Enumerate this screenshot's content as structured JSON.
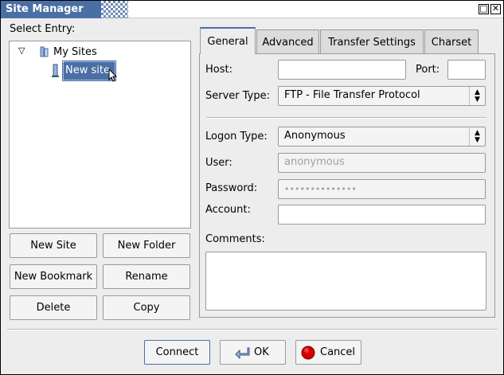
{
  "window": {
    "title": "Site Manager",
    "minimize_glyph": "□",
    "close_glyph": "✕"
  },
  "left": {
    "select_entry_label": "Select Entry:",
    "tree": {
      "root_label": "My Sites",
      "root_expander": "▽",
      "child_label": "New site"
    },
    "buttons": {
      "new_site": "New Site",
      "new_folder": "New Folder",
      "new_bookmark": "New Bookmark",
      "rename": "Rename",
      "delete": "Delete",
      "copy": "Copy"
    }
  },
  "tabs": {
    "general": "General",
    "advanced": "Advanced",
    "transfer_settings": "Transfer Settings",
    "charset": "Charset"
  },
  "general": {
    "host_label": "Host:",
    "host_value": "",
    "port_label": "Port:",
    "port_value": "",
    "server_type_label": "Server Type:",
    "server_type_value": "FTP - File Transfer Protocol",
    "logon_type_label": "Logon Type:",
    "logon_type_value": "Anonymous",
    "user_label": "User:",
    "user_value": "anonymous",
    "password_label": "Password:",
    "password_value": "••••••••••••••",
    "account_label": "Account:",
    "account_value": "",
    "comments_label": "Comments:",
    "comments_value": ""
  },
  "footer": {
    "connect": "Connect",
    "ok": "OK",
    "cancel": "Cancel"
  },
  "colors": {
    "title_bar": "#4a6fa5",
    "selection": "#4a6fa5",
    "cancel_icon": "#d40000"
  }
}
